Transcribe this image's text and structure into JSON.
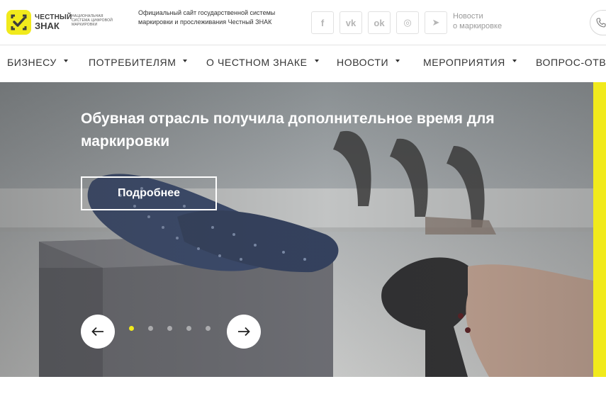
{
  "header": {
    "logo": {
      "word1": "ЧЕСТНЫЙ",
      "word2": "ЗНАК",
      "subtitle": "НАЦИОНАЛЬНАЯ СИСТЕМА ЦИФРОВОЙ МАРКИРОВКИ"
    },
    "tagline": "Официальный сайт государственной системы маркировки и прослеживания Честный ЗНАК",
    "socials": [
      {
        "name": "facebook-icon",
        "glyph": "f"
      },
      {
        "name": "vk-icon",
        "glyph": "vk"
      },
      {
        "name": "odnoklassniki-icon",
        "glyph": "ok"
      },
      {
        "name": "instagram-icon",
        "glyph": "◎"
      },
      {
        "name": "telegram-icon",
        "glyph": "➤"
      }
    ],
    "news_link_line1": "Новости",
    "news_link_line2": "о маркировке",
    "phone_icon": "phone-icon"
  },
  "nav": {
    "items": [
      {
        "label": "БИЗНЕСУ"
      },
      {
        "label": "ПОТРЕБИТЕЛЯМ"
      },
      {
        "label": "О ЧЕСТНОМ ЗНАКЕ"
      },
      {
        "label": "НОВОСТИ"
      },
      {
        "label": "МЕРОПРИЯТИЯ"
      },
      {
        "label": "ВОПРОС-ОТВЕТ"
      }
    ]
  },
  "hero": {
    "title": "Обувная отрасль получила дополнительное время для маркировки",
    "button_label": "Подробнее",
    "slides_total": 5,
    "active_slide": 1,
    "prev_icon": "arrow-left-icon",
    "next_icon": "arrow-right-icon"
  },
  "colors": {
    "brand_yellow": "#f1ea1c",
    "text_dark": "#333333",
    "muted": "#9a9a9a"
  }
}
